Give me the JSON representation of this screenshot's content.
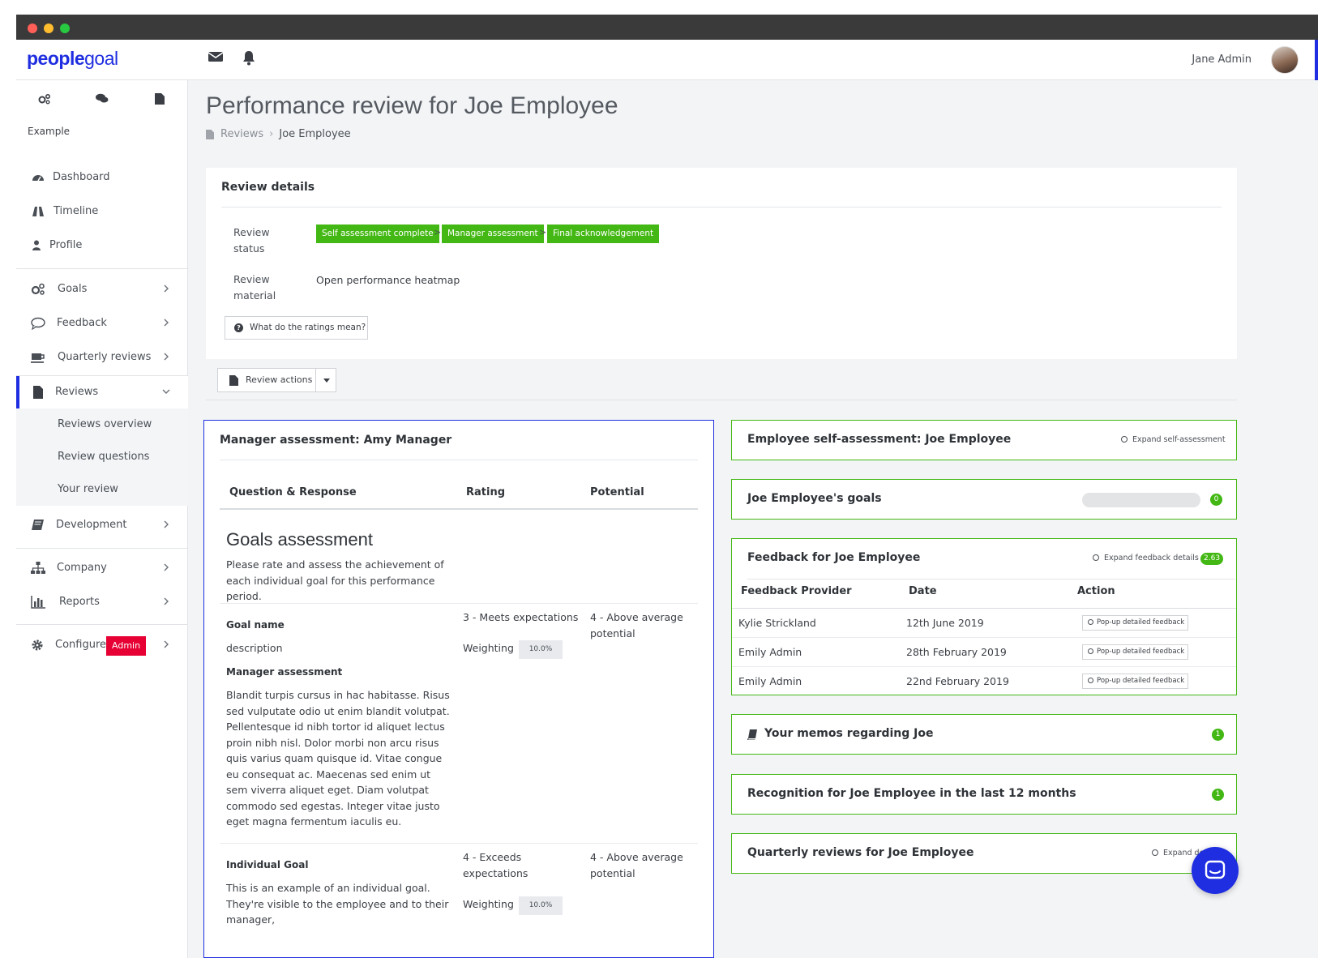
{
  "brand": {
    "logo_bold": "people",
    "logo_light": "goal",
    "accent_color": "#1f2ee0",
    "success_color": "#43b814",
    "danger_color": "#e60033"
  },
  "topbar": {
    "user_name": "Jane Admin",
    "icons": [
      "envelope-icon",
      "bell-icon"
    ]
  },
  "sidebar": {
    "org_name": "Example",
    "top_items": [
      {
        "label": "Dashboard",
        "icon": "dashboard-icon"
      },
      {
        "label": "Timeline",
        "icon": "road-icon"
      },
      {
        "label": "Profile",
        "icon": "user-icon"
      }
    ],
    "groups": [
      {
        "label": "Goals",
        "icon": "cogs-icon"
      },
      {
        "label": "Feedback",
        "icon": "comment-icon"
      },
      {
        "label": "Quarterly reviews",
        "icon": "coffee-icon"
      },
      {
        "label": "Reviews",
        "icon": "file-icon",
        "expanded": true
      },
      {
        "label": "Development",
        "icon": "book-icon"
      },
      {
        "label": "Company",
        "icon": "sitemap-icon"
      },
      {
        "label": "Reports",
        "icon": "bar-chart-icon"
      },
      {
        "label": "Configure",
        "icon": "gear-icon",
        "badge": "Admin"
      }
    ],
    "review_subitems": [
      "Reviews overview",
      "Review questions",
      "Your review"
    ]
  },
  "page": {
    "title": "Performance review for Joe Employee",
    "breadcrumb": [
      "Reviews",
      "Joe Employee"
    ]
  },
  "review_details": {
    "title": "Review details",
    "status_label": "Review status",
    "steps": [
      "Self assessment complete",
      "Manager assessment",
      "Final acknowledgement"
    ],
    "step_separator": ">",
    "material_label": "Review material",
    "material_link": "Open performance heatmap",
    "ratings_button": "What do the ratings mean?"
  },
  "review_actions": {
    "label": "Review actions"
  },
  "manager_assessment": {
    "title": "Manager assessment: Amy Manager",
    "columns": [
      "Question & Response",
      "Rating",
      "Potential"
    ],
    "section_title": "Goals assessment",
    "section_desc": "Please rate and assess the achievement of each individual goal for this performance period.",
    "goals": [
      {
        "name": "Goal name",
        "description": "description",
        "assessment_label": "Manager assessment",
        "assessment_text": "Blandit turpis cursus in hac habitasse. Risus sed vulputate odio ut enim blandit volutpat. Pellentesque id nibh tortor id aliquet lectus proin nibh nisl. Dolor morbi non arcu risus quis varius quam quisque id. Vitae congue eu consequat ac. Maecenas sed enim ut sem viverra aliquet eget. Diam volutpat commodo sed egestas. Integer vitae justo eget magna fermentum iaculis eu.",
        "rating": "3 - Meets expectations",
        "weighting_label": "Weighting",
        "weighting": "10.0%",
        "potential": "4 - Above average potential"
      },
      {
        "name": "Individual Goal",
        "description": "This is an example of an individual goal. They're visible to the employee and to their manager,",
        "rating": "4 - Exceeds expectations",
        "weighting_label": "Weighting",
        "weighting": "10.0%",
        "potential": "4 - Above average potential"
      }
    ]
  },
  "side_cards": {
    "self_assessment": {
      "title": "Employee self-assessment: Joe Employee",
      "action": "Expand self-assessment"
    },
    "goals": {
      "title": "Joe Employee's goals",
      "count": "0",
      "progress": 0
    },
    "feedback": {
      "title": "Feedback for Joe Employee",
      "action": "Expand feedback details",
      "count": "2.63",
      "columns": [
        "Feedback Provider",
        "Date",
        "Action"
      ],
      "rows": [
        {
          "provider": "Kylie Strickland",
          "date": "12th June 2019",
          "action": "Pop-up detailed feedback"
        },
        {
          "provider": "Emily Admin",
          "date": "28th February 2019",
          "action": "Pop-up detailed feedback"
        },
        {
          "provider": "Emily Admin",
          "date": "22nd February 2019",
          "action": "Pop-up detailed feedback"
        }
      ]
    },
    "memos": {
      "title": "Your memos regarding Joe",
      "count": "1"
    },
    "recognition": {
      "title": "Recognition for Joe Employee in the last 12 months",
      "count": "1"
    },
    "quarterly": {
      "title": "Quarterly reviews for Joe Employee",
      "action": "Expand de"
    }
  }
}
